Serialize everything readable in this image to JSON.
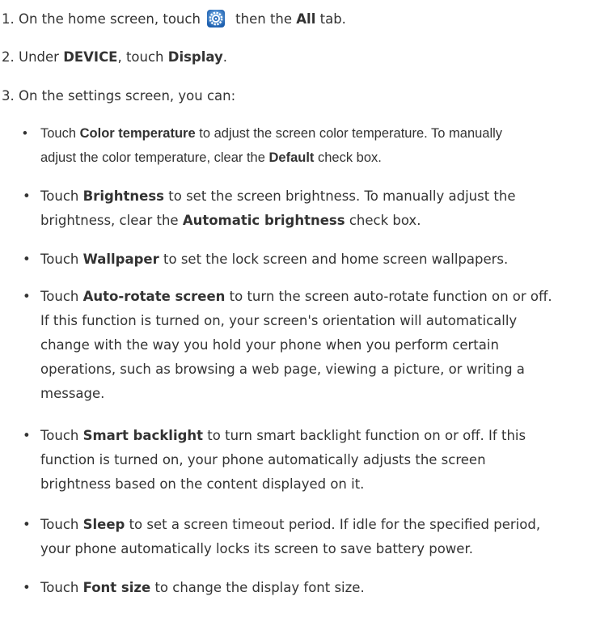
{
  "steps": [
    {
      "num": "1.",
      "pre": " On the home screen, touch",
      "icon": "settings-gear-icon",
      "mid": " then the ",
      "bold": "All",
      "post": " tab."
    },
    {
      "num": "2.",
      "pre": " Under ",
      "bold1": "DEVICE",
      "mid": ", touch ",
      "bold2": "Display",
      "post": "."
    },
    {
      "num": "3.",
      "text": " On the settings screen, you can:"
    }
  ],
  "bullet_char": "•",
  "bullets": {
    "color_temp": {
      "pre": "Touch ",
      "bold": "Color temperature",
      "post": " to adjust the screen color temperature. To manually",
      "line2_pre": "adjust the color temperature, clear the ",
      "line2_bold": "Default",
      "line2_post": " check box."
    },
    "brightness": {
      "pre": "Touch ",
      "bold": "Brightness",
      "post": " to set the screen brightness. To manually adjust the",
      "line2_pre": "brightness, clear the ",
      "line2_bold": "Automatic brightness",
      "line2_post": " check box."
    },
    "wallpaper": {
      "pre": "Touch ",
      "bold": "Wallpaper",
      "post": " to set the lock screen and home screen wallpapers."
    },
    "autorotate": {
      "pre": "Touch ",
      "bold": "Auto-rotate screen",
      "post": " to turn the screen auto-rotate function on or off.",
      "line2": "If this function is turned on, your screen's orientation will automatically",
      "line3": "change with the way you hold your phone when you perform certain",
      "line4": "operations, such as browsing a web page, viewing a picture, or writing a",
      "line5": "message."
    },
    "smart_backlight": {
      "pre": "Touch ",
      "bold": "Smart backlight",
      "post": " to turn smart backlight function on or off. If this",
      "line2": "function is turned on, your phone automatically adjusts the screen",
      "line3": "brightness based on the content displayed on it."
    },
    "sleep": {
      "pre": "Touch ",
      "bold": "Sleep",
      "post": " to set a screen timeout period. If idle for the specified period,",
      "line2": "your phone automatically locks its screen to save battery power."
    },
    "font_size": {
      "pre": "Touch ",
      "bold": "Font size",
      "post": " to change the display font size."
    }
  },
  "colors": {
    "text": "#333333",
    "icon_ring": "#1f66b8",
    "icon_bg": "#4a90d9"
  }
}
